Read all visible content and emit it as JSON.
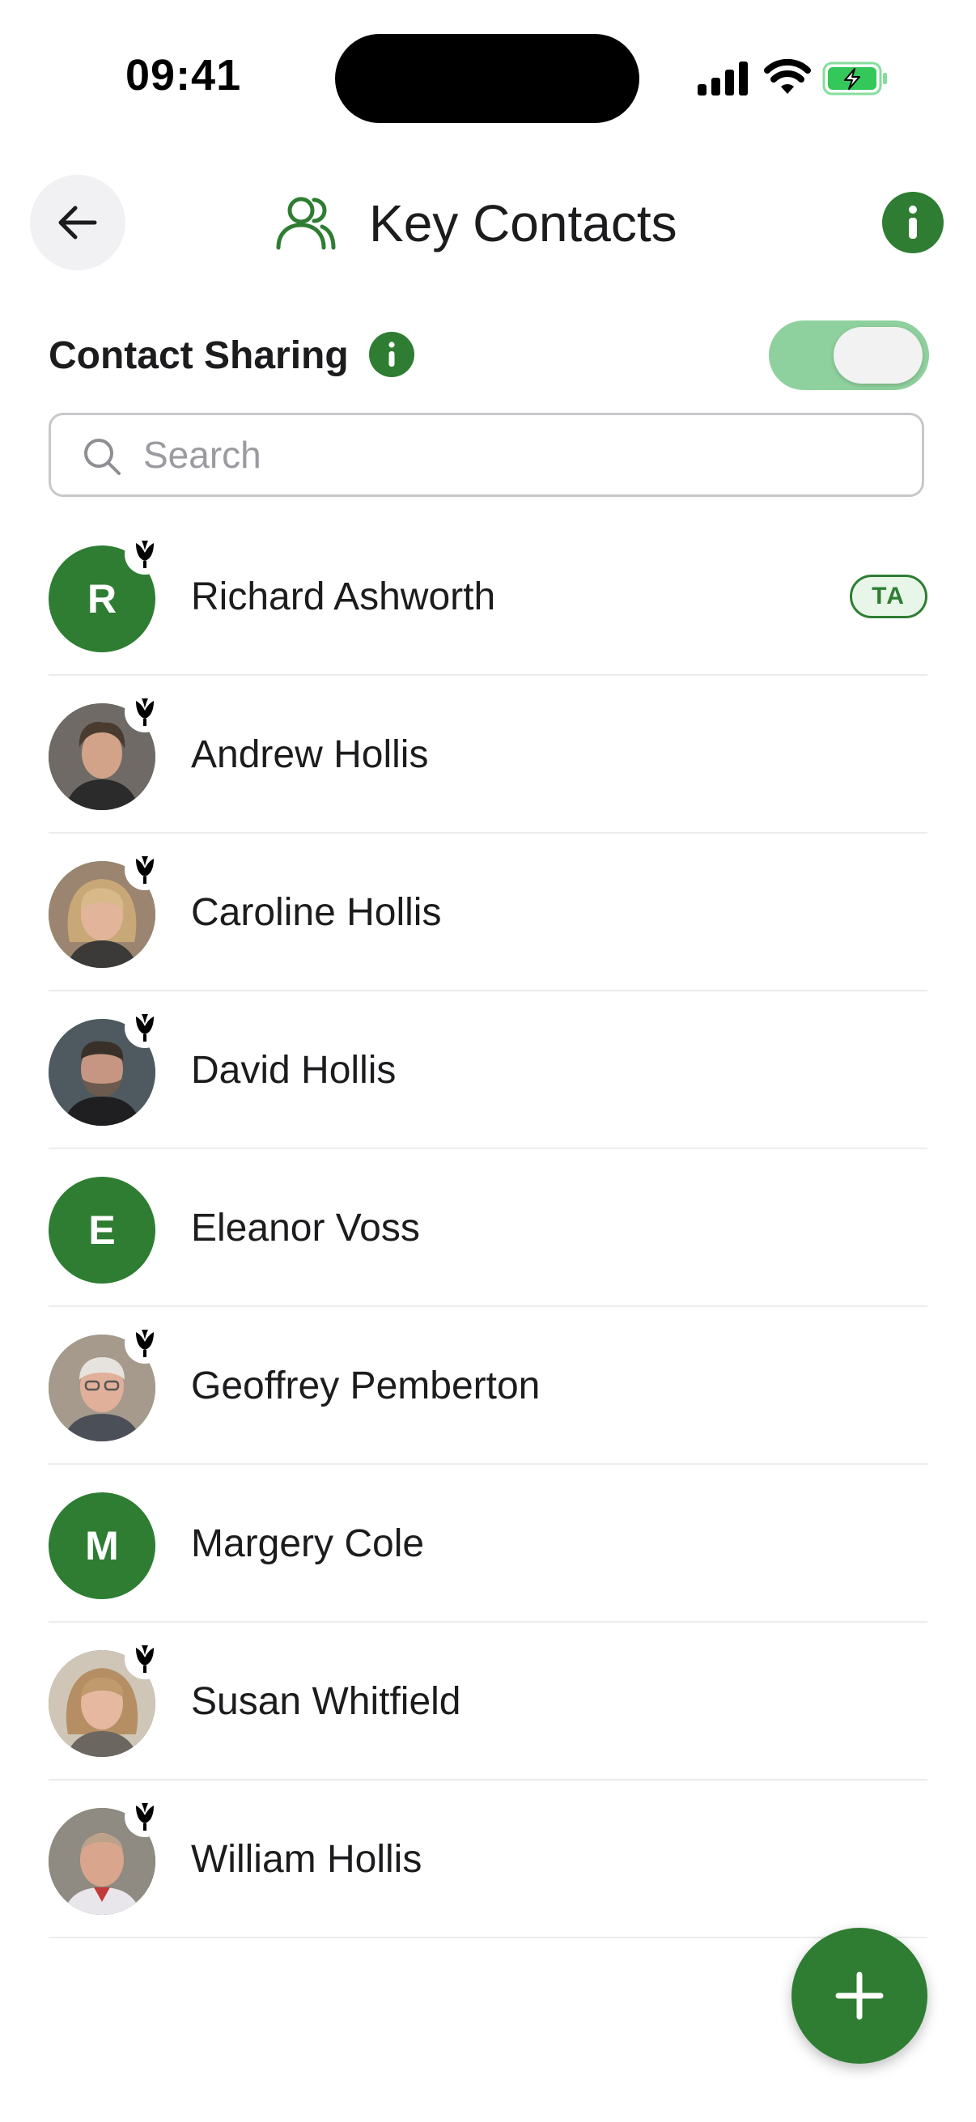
{
  "status_bar": {
    "time": "09:41",
    "icons": [
      "cellular-signal-icon",
      "wifi-icon",
      "battery-charging-icon"
    ]
  },
  "header": {
    "back_icon": "arrow-left-icon",
    "title_icon": "users-icon",
    "title": "Key Contacts",
    "info_icon": "info-icon"
  },
  "sharing": {
    "label": "Contact Sharing",
    "info_icon": "info-icon",
    "enabled": true
  },
  "search": {
    "placeholder": "Search",
    "value": ""
  },
  "contacts": [
    {
      "name": "Richard Ashworth",
      "avatar": "R",
      "photo": false,
      "app_badge": true,
      "tag": "TA"
    },
    {
      "name": "Andrew Hollis",
      "avatar": "",
      "photo": true,
      "app_badge": true,
      "tag": ""
    },
    {
      "name": "Caroline Hollis",
      "avatar": "",
      "photo": true,
      "app_badge": true,
      "tag": ""
    },
    {
      "name": "David Hollis",
      "avatar": "",
      "photo": true,
      "app_badge": true,
      "tag": ""
    },
    {
      "name": "Eleanor Voss",
      "avatar": "E",
      "photo": false,
      "app_badge": false,
      "tag": ""
    },
    {
      "name": "Geoffrey Pemberton",
      "avatar": "",
      "photo": true,
      "app_badge": true,
      "tag": ""
    },
    {
      "name": "Margery Cole",
      "avatar": "M",
      "photo": false,
      "app_badge": false,
      "tag": ""
    },
    {
      "name": "Susan Whitfield",
      "avatar": "",
      "photo": true,
      "app_badge": true,
      "tag": ""
    },
    {
      "name": "William Hollis",
      "avatar": "",
      "photo": true,
      "app_badge": true,
      "tag": ""
    }
  ],
  "fab": {
    "icon": "plus-icon"
  },
  "colors": {
    "brand_green": "#2e7d32",
    "toggle_on": "#8fd19e",
    "tag_bg": "#e8f5e9",
    "battery_green": "#34c759"
  }
}
